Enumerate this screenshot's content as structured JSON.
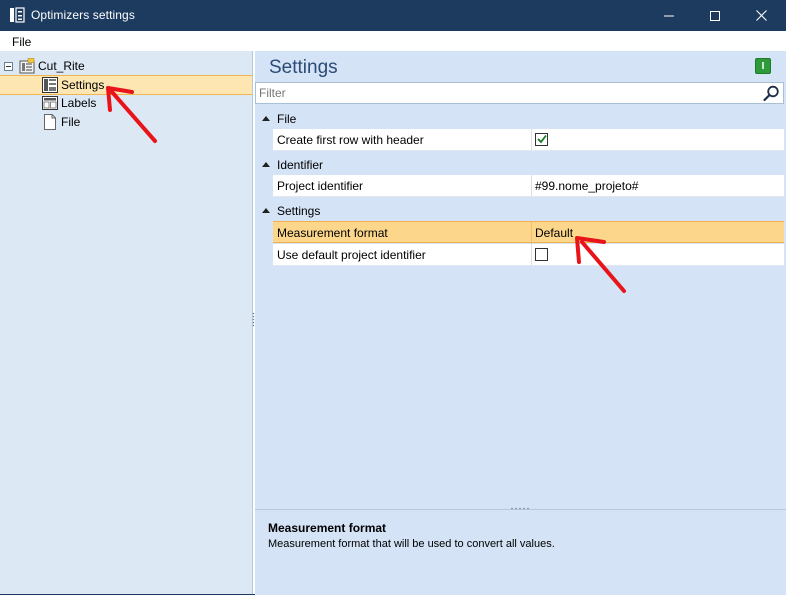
{
  "window": {
    "title": "Optimizers settings"
  },
  "menu": {
    "file_label": "File"
  },
  "tree": {
    "root": {
      "label": "Cut_Rite"
    },
    "items": [
      {
        "label": "Settings"
      },
      {
        "label": "Labels"
      },
      {
        "label": "File"
      }
    ]
  },
  "panel": {
    "heading": "Settings",
    "green_button_label": "I",
    "filter_placeholder": "Filter"
  },
  "grid": {
    "categories": [
      {
        "label": "File",
        "rows": [
          {
            "name": "Create first row with header",
            "checked": true
          }
        ]
      },
      {
        "label": "Identifier",
        "rows": [
          {
            "name": "Project identifier",
            "value": "#99.nome_projeto#"
          }
        ]
      },
      {
        "label": "Settings",
        "rows": [
          {
            "name": "Measurement format",
            "value": "Default"
          },
          {
            "name": "Use default project identifier",
            "checked": false
          }
        ]
      }
    ]
  },
  "description": {
    "title": "Measurement format",
    "text": "Measurement format that will be used to convert all values."
  },
  "colors": {
    "titlebar": "#1d3b5e",
    "selection": "#fbd68b",
    "panel": "#d4e3f6",
    "annotation": "#e8141a"
  }
}
